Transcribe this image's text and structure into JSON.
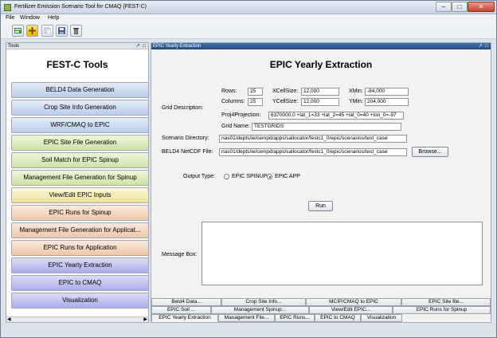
{
  "window": {
    "title": "Fertilizer Emission Scenario Tool for CMAQ (FEST-C)",
    "minimize": "–",
    "maximize": "□",
    "close": "✕"
  },
  "menu": [
    "File",
    "Window",
    "Help"
  ],
  "toolbar": [
    "new-project-icon",
    "add-icon",
    "copy-icon",
    "save-icon",
    "delete-icon"
  ],
  "tools_panel": {
    "header": "Tools",
    "header_controls": "↗ □",
    "title": "FEST-C Tools",
    "buttons": [
      {
        "label": "BELD4 Data Generation",
        "color": "#b9ccea"
      },
      {
        "label": "Crop Site Info Generation",
        "color": "#b9ccea"
      },
      {
        "label": "WRF/CMAQ to EPIC",
        "color": "#b9ccea"
      },
      {
        "label": "EPIC Site File Generation",
        "color": "#cde3a5"
      },
      {
        "label": "Soil Match for EPIC Spinup",
        "color": "#cde3a5"
      },
      {
        "label": "Management File Generation for Spinup",
        "color": "#cde3a5"
      },
      {
        "label": "View/Edit EPIC Inputs",
        "color": "#efe29c"
      },
      {
        "label": "EPIC Runs for Spinup",
        "color": "#efc7a8"
      },
      {
        "label": "Management File Generation for Applicat...",
        "color": "#efc7a8"
      },
      {
        "label": "EPIC Runs for Application",
        "color": "#efc7a8"
      },
      {
        "label": "EPIC Yearly Extraction",
        "color": "#a9acea"
      },
      {
        "label": "EPIC to CMAQ",
        "color": "#a9acea"
      },
      {
        "label": "Visualization",
        "color": "#a9acea"
      }
    ],
    "scroll_left": "◀",
    "scroll_right": "▶"
  },
  "main_panel": {
    "header": "EPIC Yearly Extraction",
    "header_controls": "↗ □",
    "title": "EPIC Yearly Extraction",
    "grid_description_label": "Grid Description:",
    "rows_label": "Rows:",
    "rows_value": "25",
    "columns_label": "Columns:",
    "columns_value": "25",
    "xcellsize_label": "XCellSize:",
    "xcellsize_value": "12,000",
    "ycellsize_label": "YCellSize:",
    "ycellsize_value": "12,000",
    "xmin_label": "XMin:",
    "xmin_value": "-84,000",
    "ymin_label": "YMin:",
    "ymin_value": "204,000",
    "proj_label": "Proj4Projection:",
    "proj_value": "6370000.0 +lat_1=33 +lat_2=45 +lat_0=40 +lon_0=-97",
    "gridname_label": "Grid Name:",
    "gridname_value": "TESTGRIDS",
    "scenario_label": "Scenario Directory:",
    "scenario_value": "nas01/depts/ie/cempd/apps/sallocator/festc1_0/epic/scenarios/test_case",
    "beld4_label": "BELD4 NetCDF File:",
    "beld4_value": "nas01/depts/ie/cempd/apps/sallocator/festc1_0/epic/scenarios/test_case",
    "browse_label": "Browse...",
    "output_type_label": "Output Type:",
    "option_spinup": "EPIC SPINUP",
    "option_app": "EPIC APP",
    "run_label": "Run",
    "message_label": "Message Box:"
  },
  "tabs": {
    "row1": [
      "Beld4 Data...",
      "Crop Site Info...",
      "MCIP/CMAQ to EPIC",
      "EPIC Site file..."
    ],
    "row2": [
      "EPIC Soil ...",
      "Management Spinup...",
      "View/Edit EPIC...",
      "EPIC Runs for Spinup"
    ],
    "row3": [
      "EPIC Yearly Extraction",
      "Management File...",
      "EPIC Runs...",
      "EPIC to CMAQ",
      "Visualization"
    ]
  }
}
